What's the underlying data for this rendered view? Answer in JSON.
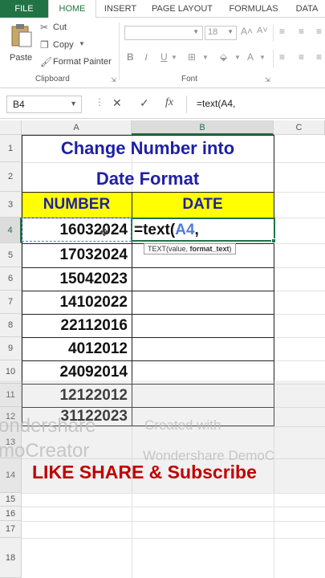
{
  "ribbon": {
    "tabs": [
      "FILE",
      "HOME",
      "INSERT",
      "PAGE LAYOUT",
      "FORMULAS",
      "DATA"
    ],
    "clipboard": {
      "paste": "Paste",
      "cut": "Cut",
      "copy": "Copy",
      "format_painter": "Format Painter",
      "group_label": "Clipboard"
    },
    "font": {
      "size": "18",
      "group_label": "Font",
      "bold": "B",
      "italic": "I",
      "underline": "U"
    }
  },
  "formula_bar": {
    "name_box": "B4",
    "formula": "=text(A4,"
  },
  "grid": {
    "columns": [
      "A",
      "B",
      "C"
    ],
    "rows": [
      "1",
      "2",
      "3",
      "4",
      "5",
      "6",
      "7",
      "8",
      "9",
      "10",
      "11",
      "12",
      "13",
      "14",
      "15",
      "16",
      "17",
      "18"
    ],
    "title_line1": "Change Number into",
    "title_line2": "Date Format",
    "header_number": "NUMBER",
    "header_date": "DATE",
    "numbers": [
      "16032024",
      "17032024",
      "15042023",
      "14102022",
      "22112016",
      "4012012",
      "24092014",
      "12122012",
      "31122023"
    ],
    "editing": {
      "prefix": "=text(",
      "ref": "A4",
      "suffix": ","
    },
    "tooltip": {
      "fn": "TEXT(value, ",
      "arg": "format_text",
      "close": ")"
    }
  },
  "overlay": {
    "watermark_left1": "ondershare",
    "watermark_left2": "moCreator",
    "watermark_right1": "Created with",
    "watermark_right2": "Wondershare DemoC",
    "like_share": "LIKE SHARE & Subscribe"
  }
}
